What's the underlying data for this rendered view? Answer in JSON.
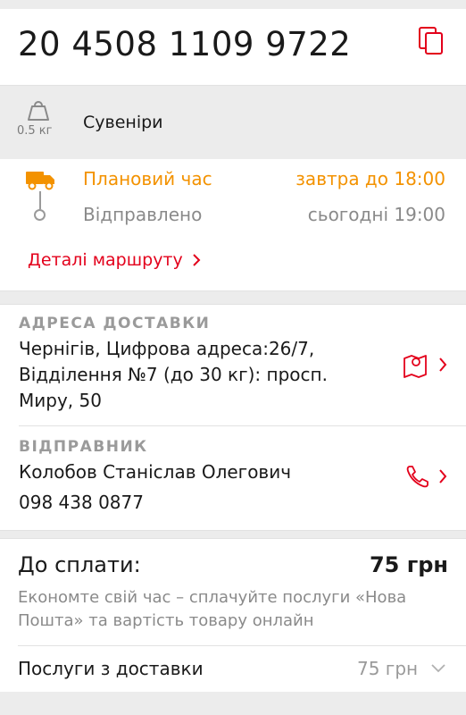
{
  "tracking": {
    "number": "20 4508 1109 9722",
    "copy_icon": "copy-icon"
  },
  "cargo": {
    "weight": "0.5 кг",
    "description": "Сувеніри",
    "weight_icon": "weight-icon"
  },
  "status": {
    "planned_label": "Плановий час",
    "planned_value": "завтра до 18:00",
    "sent_label": "Відправлено",
    "sent_value": "сьогодні 19:00",
    "route_link": "Деталі маршруту",
    "truck_icon": "truck-icon",
    "accent_color": "#f39200"
  },
  "delivery_address": {
    "title": "АДРЕСА ДОСТАВКИ",
    "text": "Чернігів, Цифрова адреса:26/7, Відділення №7 (до 30 кг): просп. Миру, 50",
    "map_icon": "map-pin-icon"
  },
  "sender": {
    "title": "ВІДПРАВНИК",
    "name": "Колобов Станіслав Олегович",
    "phone": "098 438 0877",
    "phone_icon": "phone-icon"
  },
  "payment": {
    "label": "До сплати:",
    "amount": "75 грн",
    "note": "Економте свій час – сплачуйте послуги «Нова Пошта» та вартість товару онлайн",
    "services_label": "Послуги з доставки",
    "services_value": "75 грн"
  },
  "colors": {
    "brand_red": "#e3001b",
    "orange": "#f39200"
  }
}
